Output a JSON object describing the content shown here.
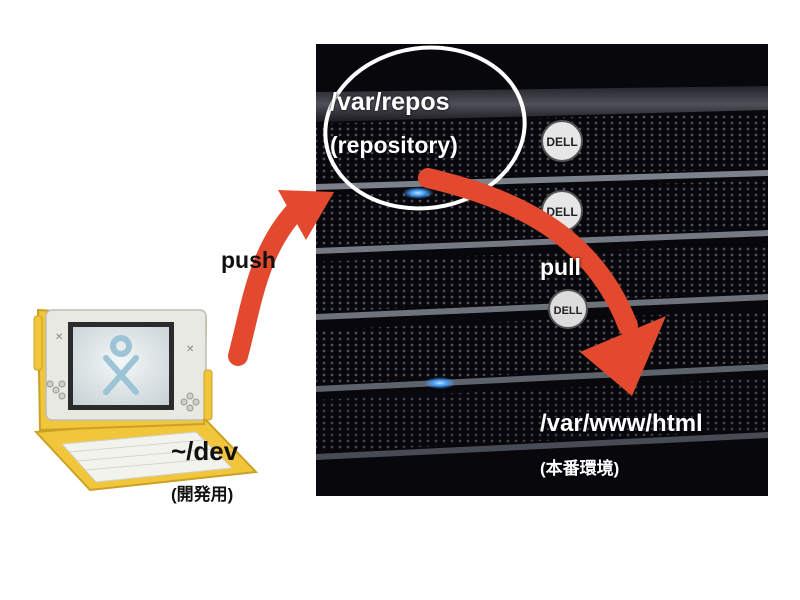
{
  "labels": {
    "push": "push",
    "pull": "pull",
    "repo_path": "/var/repos",
    "repo_desc": "(repository)",
    "prod_path": "/var/www/html",
    "prod_desc": "(本番環境)",
    "dev_path": "~/dev",
    "dev_desc": "(開発用)"
  },
  "server_brand": "DELL",
  "colors": {
    "arrow": "#e2492f",
    "server_bg": "#07070c",
    "laptop_body": "#f2c63a",
    "laptop_frame": "#e9e9e4",
    "led": "#4aa3ff"
  },
  "icons": {
    "laptop": "olpc-xo-laptop-icon",
    "server": "server-rack-photo",
    "arrow": "curved-arrow-icon"
  }
}
